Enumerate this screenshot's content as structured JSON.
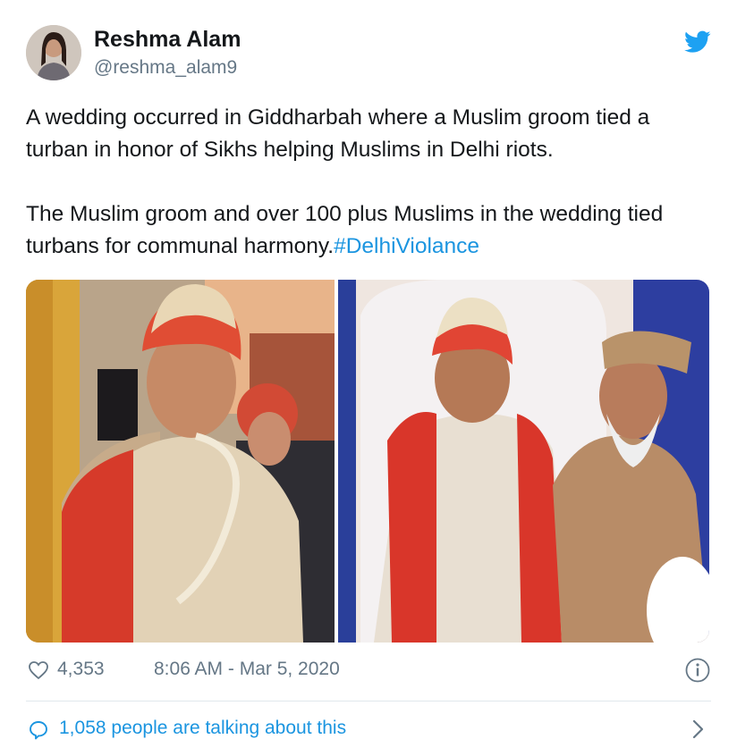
{
  "tweet": {
    "author": {
      "name": "Reshma Alam",
      "handle": "@reshma_alam9",
      "avatar_icon": "user-avatar"
    },
    "brand_icon": "twitter-bird-icon",
    "text_line_1": "A wedding occurred in Giddharbah where a Muslim groom tied a turban in honor of Sikhs helping Muslims in Delhi riots.",
    "text_line_2_prefix": "The Muslim groom and over 100 plus Muslims in the wedding tied turbans for communal harmony.",
    "hashtag": "#DelhiViolance",
    "likes": "4,353",
    "timestamp": "8:06 AM - Mar 5, 2020",
    "talking_label": "1,058 people are talking about this"
  },
  "colors": {
    "accent": "#1b95e0",
    "text": "#14171a",
    "muted": "#657786",
    "divider": "#e1e8ed"
  }
}
